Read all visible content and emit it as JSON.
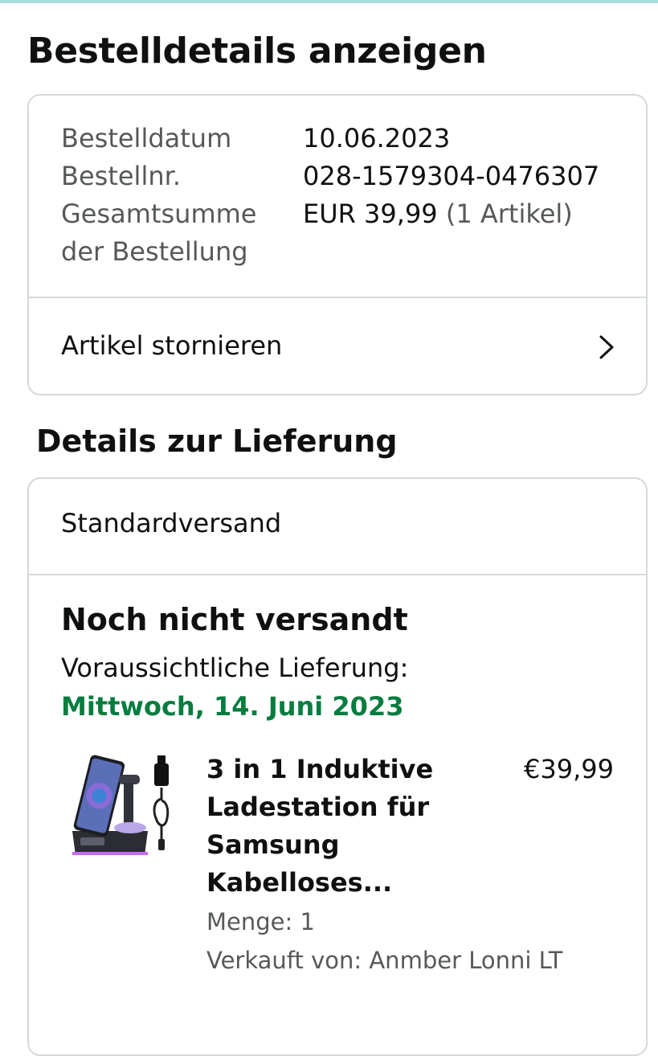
{
  "page": {
    "title": "Bestelldetails anzeigen"
  },
  "order_summary": {
    "date_label": "Bestelldatum",
    "date_value": "10.06.2023",
    "number_label": "Bestellnr.",
    "number_value": "028-1579304-0476307",
    "total_label_line1": "Gesamtsumme",
    "total_label_line2": "der Bestellung",
    "total_value": "EUR 39,99",
    "total_items": "(1 Artikel)",
    "cancel_label": "Artikel stornieren"
  },
  "delivery": {
    "section_title": "Details zur Lieferung",
    "shipping_method": "Standardversand",
    "status": "Noch nicht versandt",
    "eta_label": "Voraussichtliche Lieferung:",
    "eta_date": "Mittwoch, 14. Juni 2023",
    "item": {
      "title": "3 in 1 Induktive Ladestation für Samsung Kabelloses...",
      "price": "€39,99",
      "quantity": "Menge: 1",
      "seller": "Verkauft von: Anmber Lonni LT"
    }
  },
  "colors": {
    "eta_green": "#067d3e",
    "border": "#d5d9d9",
    "muted_text": "#565959",
    "top_strip": "#a8dedb"
  },
  "icons": {
    "cancel_chevron": "chevron-right-icon"
  }
}
